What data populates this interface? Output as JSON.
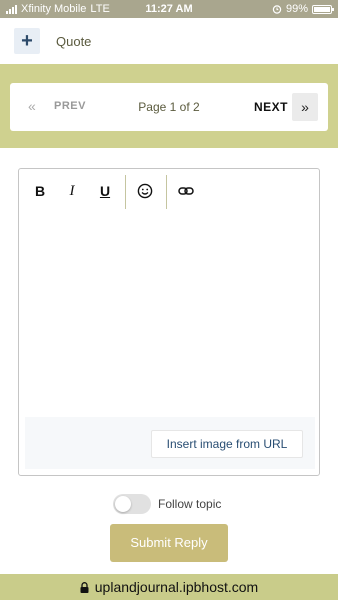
{
  "status_bar": {
    "carrier": "Xfinity Mobile",
    "network": "LTE",
    "time": "11:27 AM",
    "battery": "99%",
    "battery_level": 0.99
  },
  "quote_bar": {
    "plus_symbol": "+",
    "label": "Quote"
  },
  "pagination": {
    "prev_label": "PREV",
    "page_label": "Page 1 of 2",
    "next_label": "NEXT",
    "prev_icon": "double-chevron-left-icon",
    "next_icon": "double-chevron-right-icon"
  },
  "editor": {
    "toolbar": {
      "bold": "B",
      "italic": "I",
      "underline": "U",
      "emoji_icon": "smiley-icon",
      "link_icon": "link-icon"
    },
    "insert_image_label": "Insert image from URL"
  },
  "follow_topic": {
    "label": "Follow topic",
    "enabled": false
  },
  "submit_label": "Submit Reply",
  "browser": {
    "url": "uplandjournal.ipbhost.com"
  },
  "colors": {
    "accent_band": "#cfd18f",
    "submit_button": "#c9bc7a",
    "status_bar": "#a9a68e",
    "link_text": "#294e73"
  }
}
